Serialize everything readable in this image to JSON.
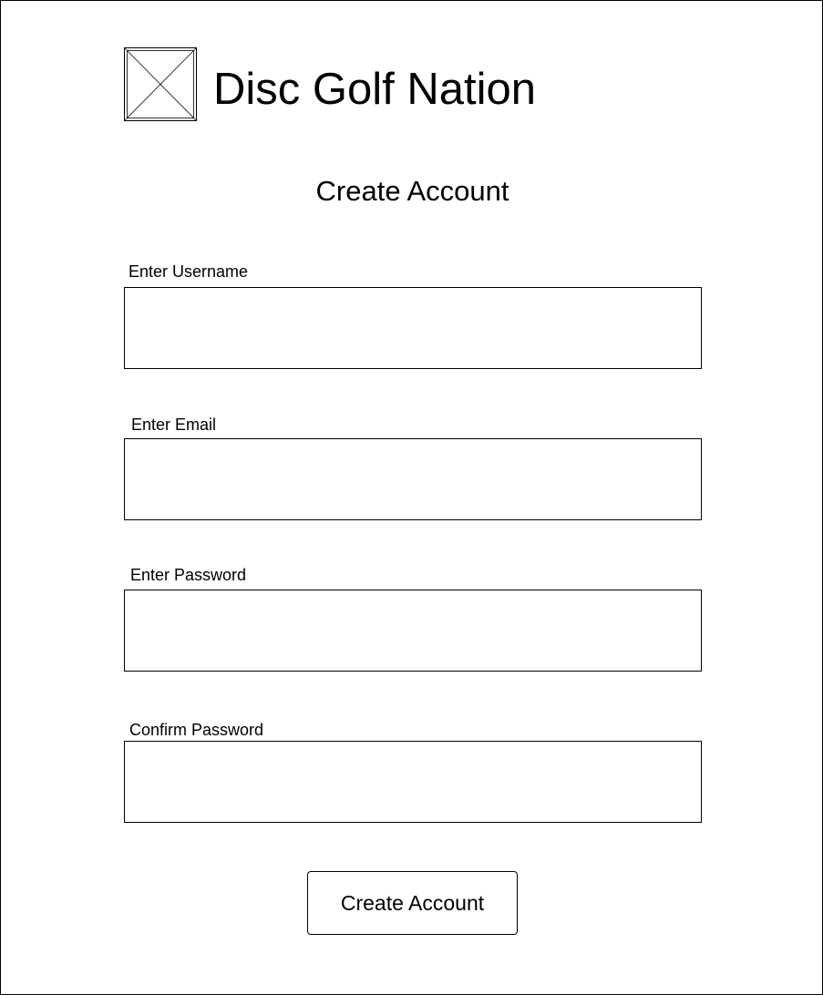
{
  "header": {
    "logo_icon": "image-placeholder-icon",
    "app_title": "Disc Golf Nation"
  },
  "page": {
    "heading": "Create Account"
  },
  "form": {
    "fields": [
      {
        "label": "Enter Username",
        "value": "",
        "placeholder": ""
      },
      {
        "label": "Enter Email",
        "value": "",
        "placeholder": ""
      },
      {
        "label": "Enter Password",
        "value": "",
        "placeholder": ""
      },
      {
        "label": "Confirm Password",
        "value": "",
        "placeholder": ""
      }
    ],
    "submit_label": "Create Account"
  },
  "colors": {
    "background": "#ffffff",
    "stroke": "#000000",
    "text": "#000000"
  }
}
